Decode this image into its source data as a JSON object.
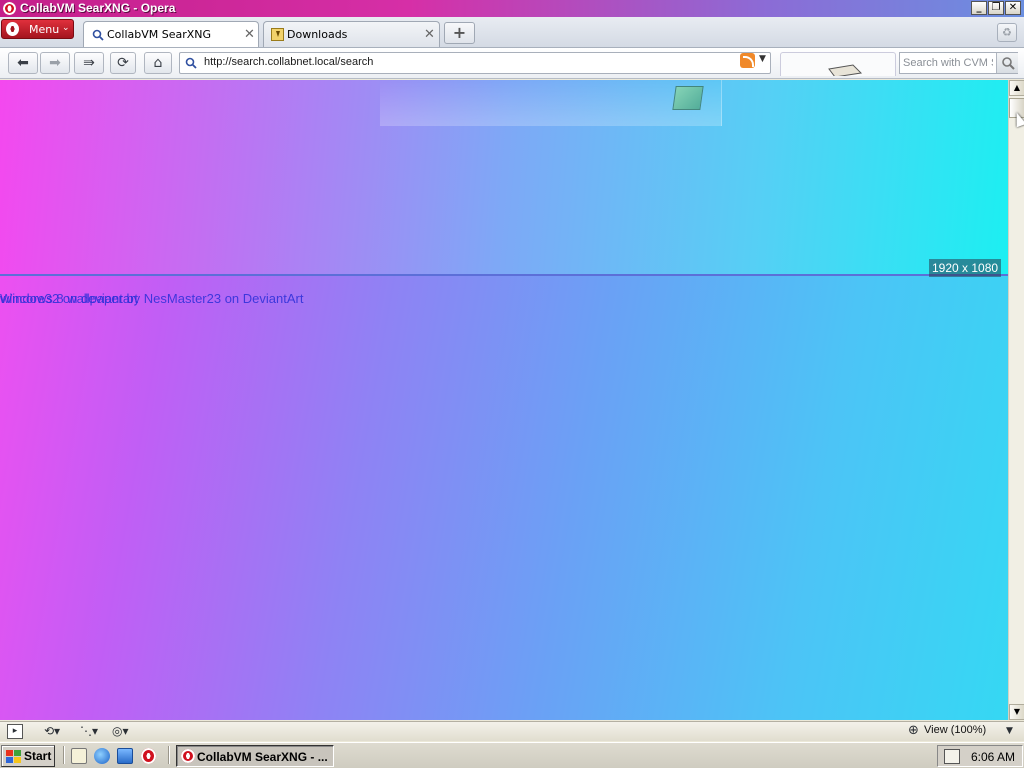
{
  "window": {
    "title": "CollabVM SearXNG - Opera"
  },
  "tabstrip": {
    "menu_label": "Menu",
    "tabs": [
      {
        "label": "CollabVM SearXNG",
        "active": true
      },
      {
        "label": "Downloads",
        "active": false
      }
    ]
  },
  "addressbar": {
    "url": "http://search.collabnet.local/search",
    "search_placeholder": "Search with CVM SearXNG"
  },
  "content": {
    "image_dims": "1920 x 1080",
    "result_title_a": "Windows 8 wallpaper by NesMaster23 on DeviantArt",
    "result_title_b": "wincore32 on deviantart"
  },
  "statusbar": {
    "view_zoom": "View (100%)"
  },
  "taskbar": {
    "start_label": "Start",
    "active_task": "CollabVM SearXNG - ...",
    "clock": "6:06 AM"
  },
  "colors": {
    "opera_red": "#d0101e",
    "gradient_magenta": "#f448ef",
    "gradient_cyan": "#1ceff2",
    "link_blue": "#2b2fd8"
  },
  "icons": [
    "opera-logo-icon",
    "back-icon",
    "forward-icon",
    "fast-forward-icon",
    "reload-icon",
    "home-icon",
    "rss-icon",
    "search-icon",
    "close-icon",
    "plus-icon",
    "trash-icon"
  ]
}
